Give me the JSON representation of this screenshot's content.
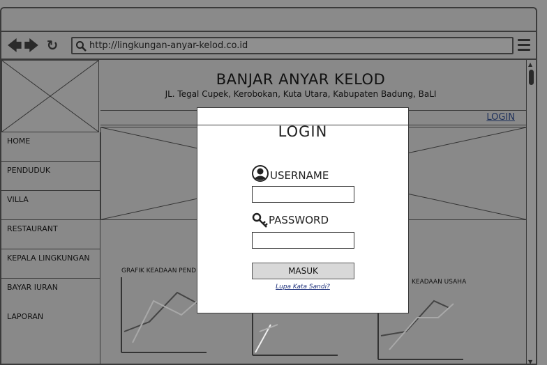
{
  "browser": {
    "url": "http://lingkungan-anyar-kelod.co.id",
    "back_icon": "arrow-left",
    "forward_icon": "arrow-right",
    "reload_icon": "reload",
    "menu_icon": "hamburger"
  },
  "site": {
    "title": "BANJAR ANYAR KELOD",
    "address": "JL. Tegal Cupek, Kerobokan, Kuta Utara, Kabupaten Badung, BaLI",
    "login_link": "LOGIN"
  },
  "sidebar": {
    "items": [
      {
        "label": "HOME"
      },
      {
        "label": "PENDUDUK"
      },
      {
        "label": "VILLA"
      },
      {
        "label": "RESTAURANT"
      },
      {
        "label": "KEPALA LINGKUNGAN"
      },
      {
        "label": "BAYAR IURAN"
      },
      {
        "label": "LAPORAN"
      }
    ]
  },
  "charts": {
    "left_title": "GRAFIK KEADAAN PEND",
    "right_title": "KEADAAN USAHA"
  },
  "modal": {
    "title": "LOGIN",
    "username_label": "USERNAME",
    "password_label": "PASSWORD",
    "username_value": "",
    "password_value": "",
    "submit_label": "MASUK",
    "forgot_label": "Lupa Kata Sandi?"
  },
  "colors": {
    "dim_background": "#898989",
    "modal_background": "#ffffff",
    "link": "#1c2f5a"
  }
}
